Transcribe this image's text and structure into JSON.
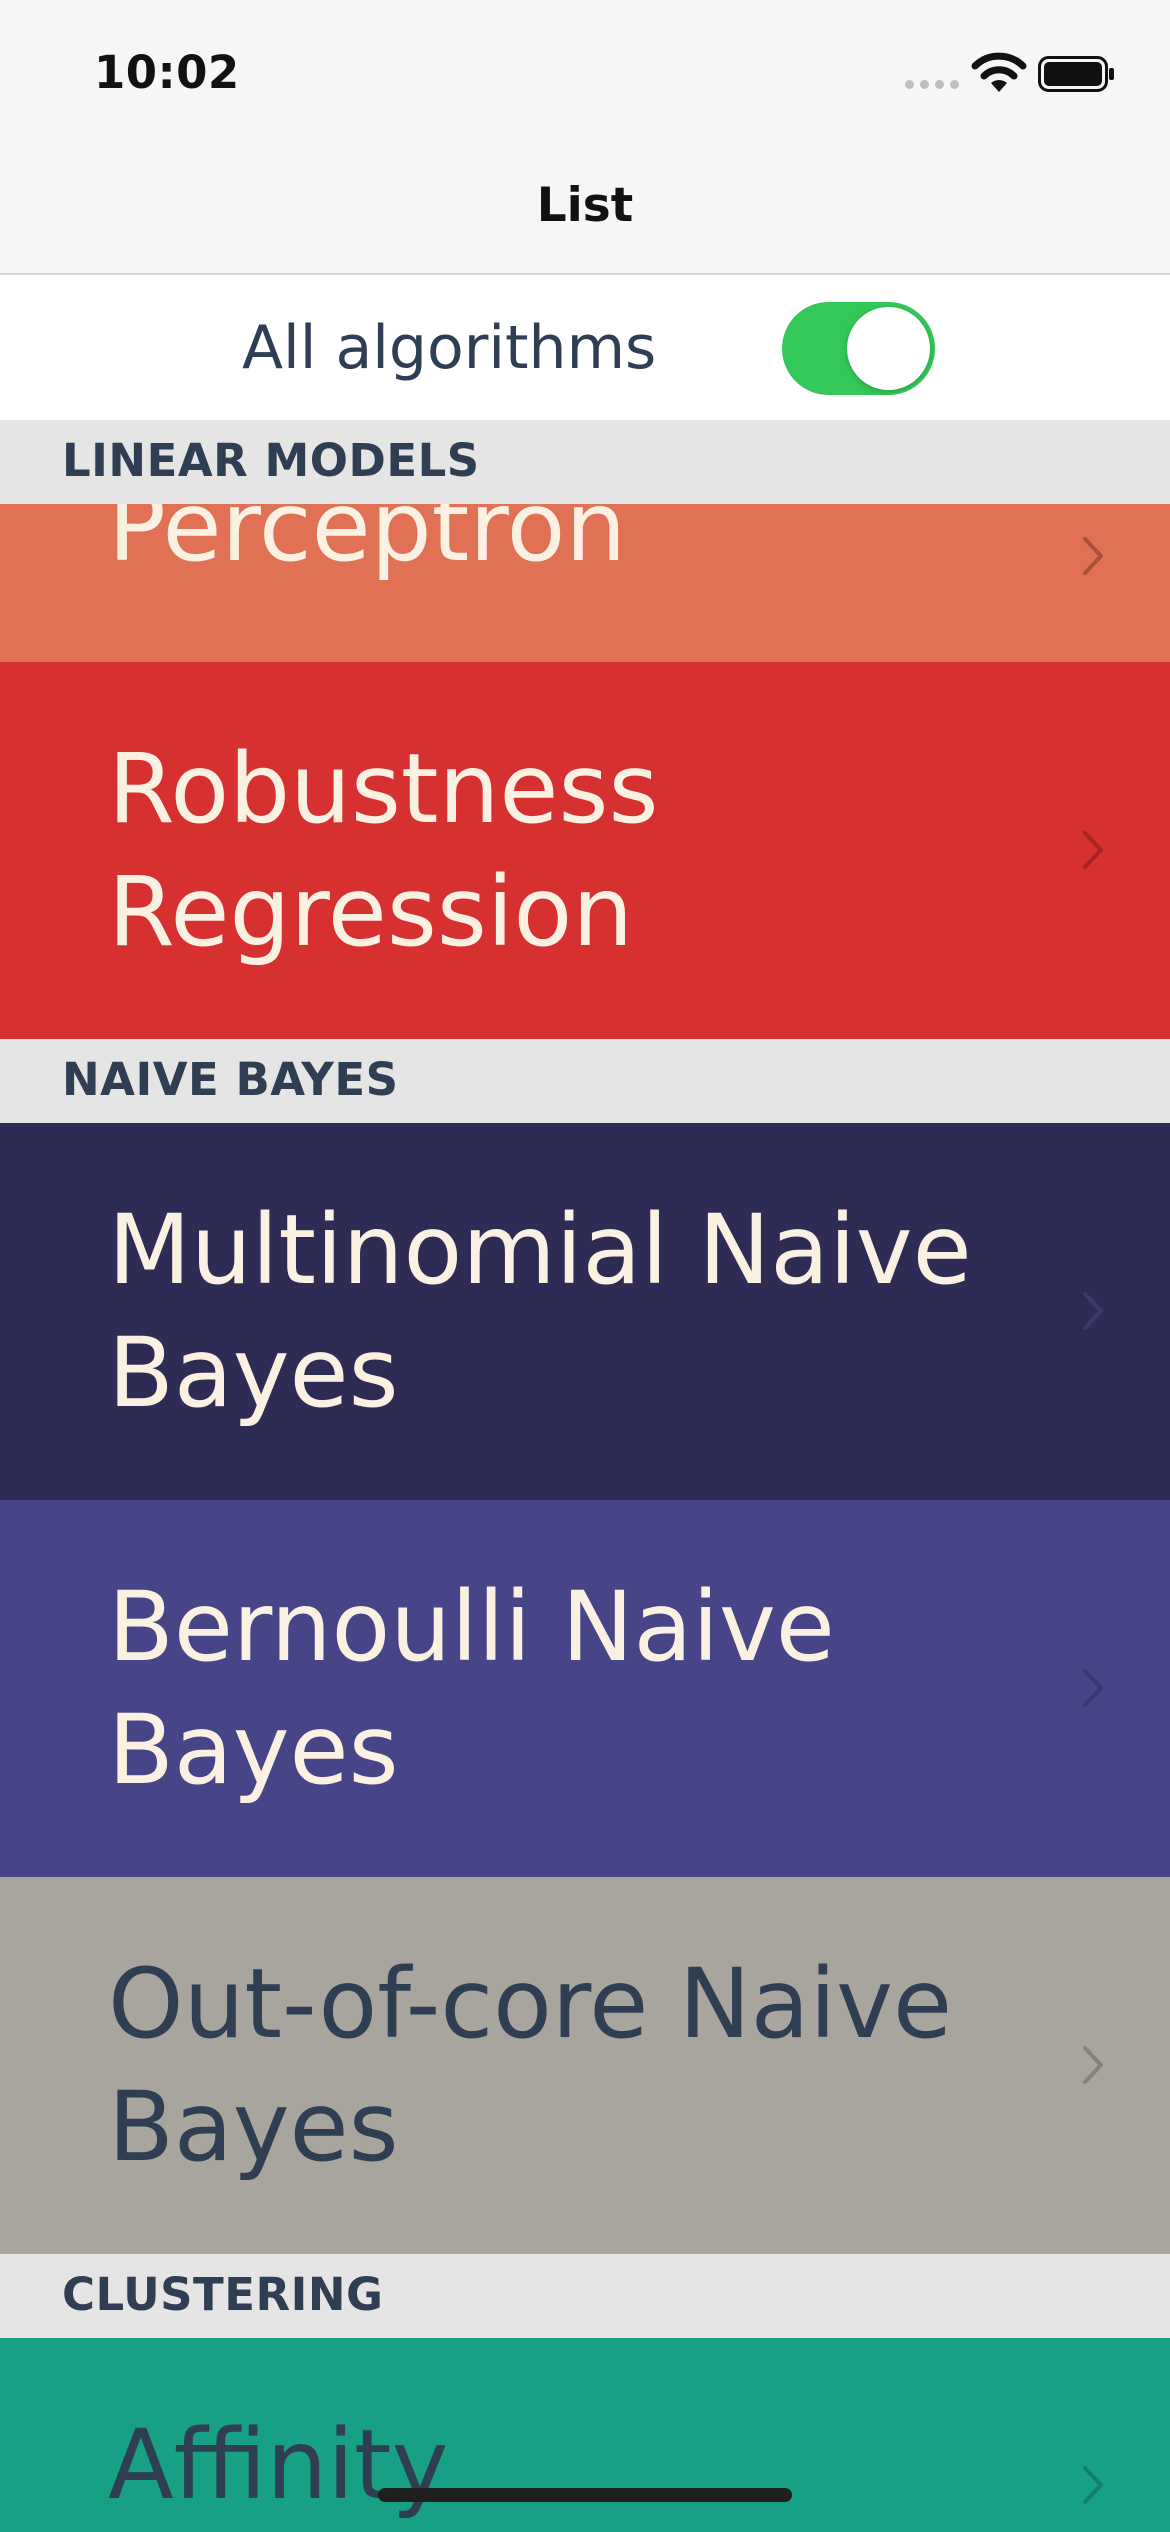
{
  "status_bar": {
    "time": "10:02",
    "icons": [
      "signal-icon",
      "wifi-icon",
      "battery-icon"
    ]
  },
  "nav": {
    "title": "List"
  },
  "toggle": {
    "label": "All algorithms",
    "on": true,
    "color": "#34c759"
  },
  "sections": {
    "linear_models": {
      "title": "LINEAR MODELS"
    },
    "naive_bayes": {
      "title": "NAIVE BAYES"
    },
    "clustering": {
      "title": "CLUSTERING"
    }
  },
  "rows": {
    "perceptron": {
      "title": "Perceptron",
      "bg": "#e07155",
      "fg": "#fbf1e3"
    },
    "robustness_regression": {
      "title": "Robustness Regression",
      "bg": "#d63030",
      "fg": "#fbf1e3"
    },
    "multinomial_naive_bayes": {
      "title": "Multinomial Naive Bayes",
      "bg": "#2e2b55",
      "fg": "#fbf1e3"
    },
    "bernoulli_naive_bayes": {
      "title": "Bernoulli Naive Bayes",
      "bg": "#474587",
      "fg": "#fbf1e3"
    },
    "out_of_core_naive_bayes": {
      "title": "Out-of-core Naive Bayes",
      "bg": "#a8a49e",
      "fg": "#2f3e52"
    },
    "affinity_propagation": {
      "title": "Affinity Propagation",
      "bg": "#18a085",
      "fg": "#2f3e52"
    }
  }
}
